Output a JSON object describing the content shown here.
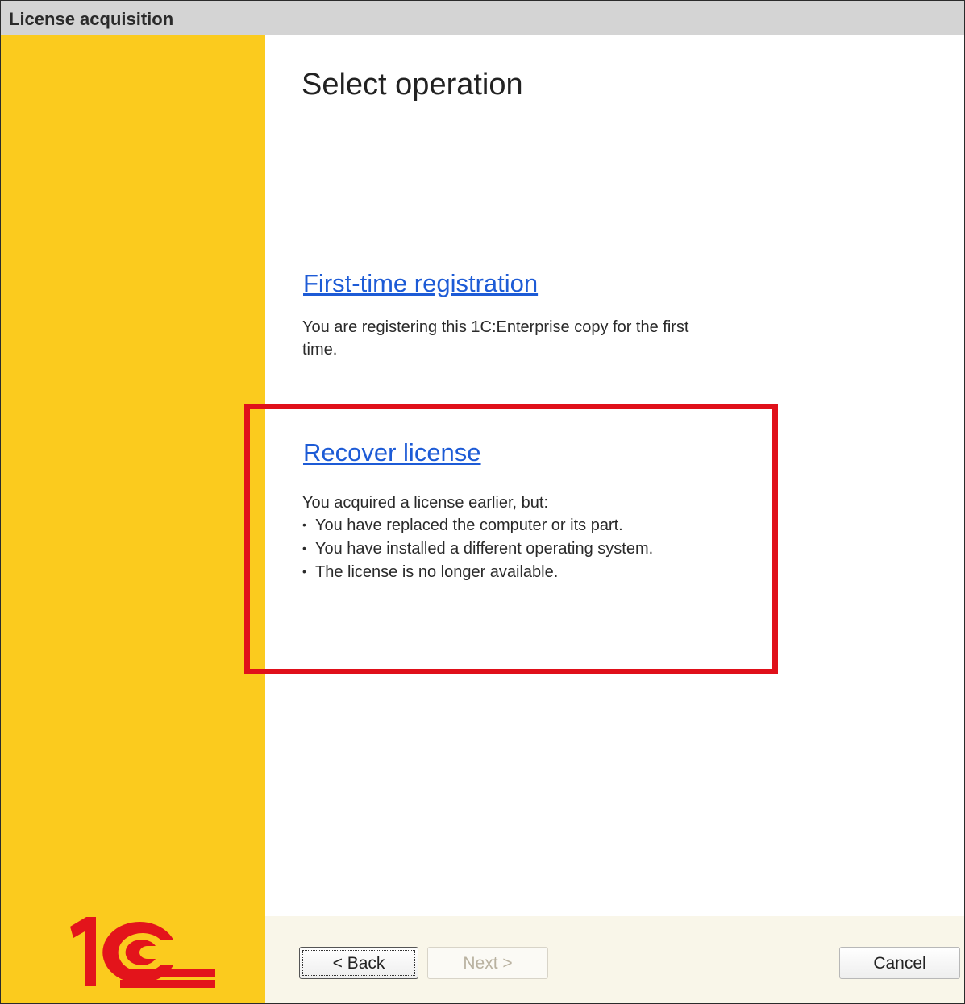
{
  "window": {
    "title": "License acquisition"
  },
  "main": {
    "heading": "Select operation",
    "operations": [
      {
        "link": "First-time registration",
        "description": "You are registering this 1C:Enterprise copy for the first time."
      },
      {
        "link": "Recover license",
        "intro": "You acquired a license earlier, but:",
        "bullets": [
          "You have replaced the computer or its part.",
          "You have installed a different operating system.",
          "The license is no longer available."
        ]
      }
    ]
  },
  "footer": {
    "back_label": "< Back",
    "next_label": "Next >",
    "cancel_label": "Cancel"
  },
  "brand": {
    "logo": "1C",
    "colors": {
      "sidebar": "#fbcb1e",
      "logo_red": "#e3141b",
      "link": "#1d5bd6",
      "highlight": "#e0101a"
    }
  }
}
